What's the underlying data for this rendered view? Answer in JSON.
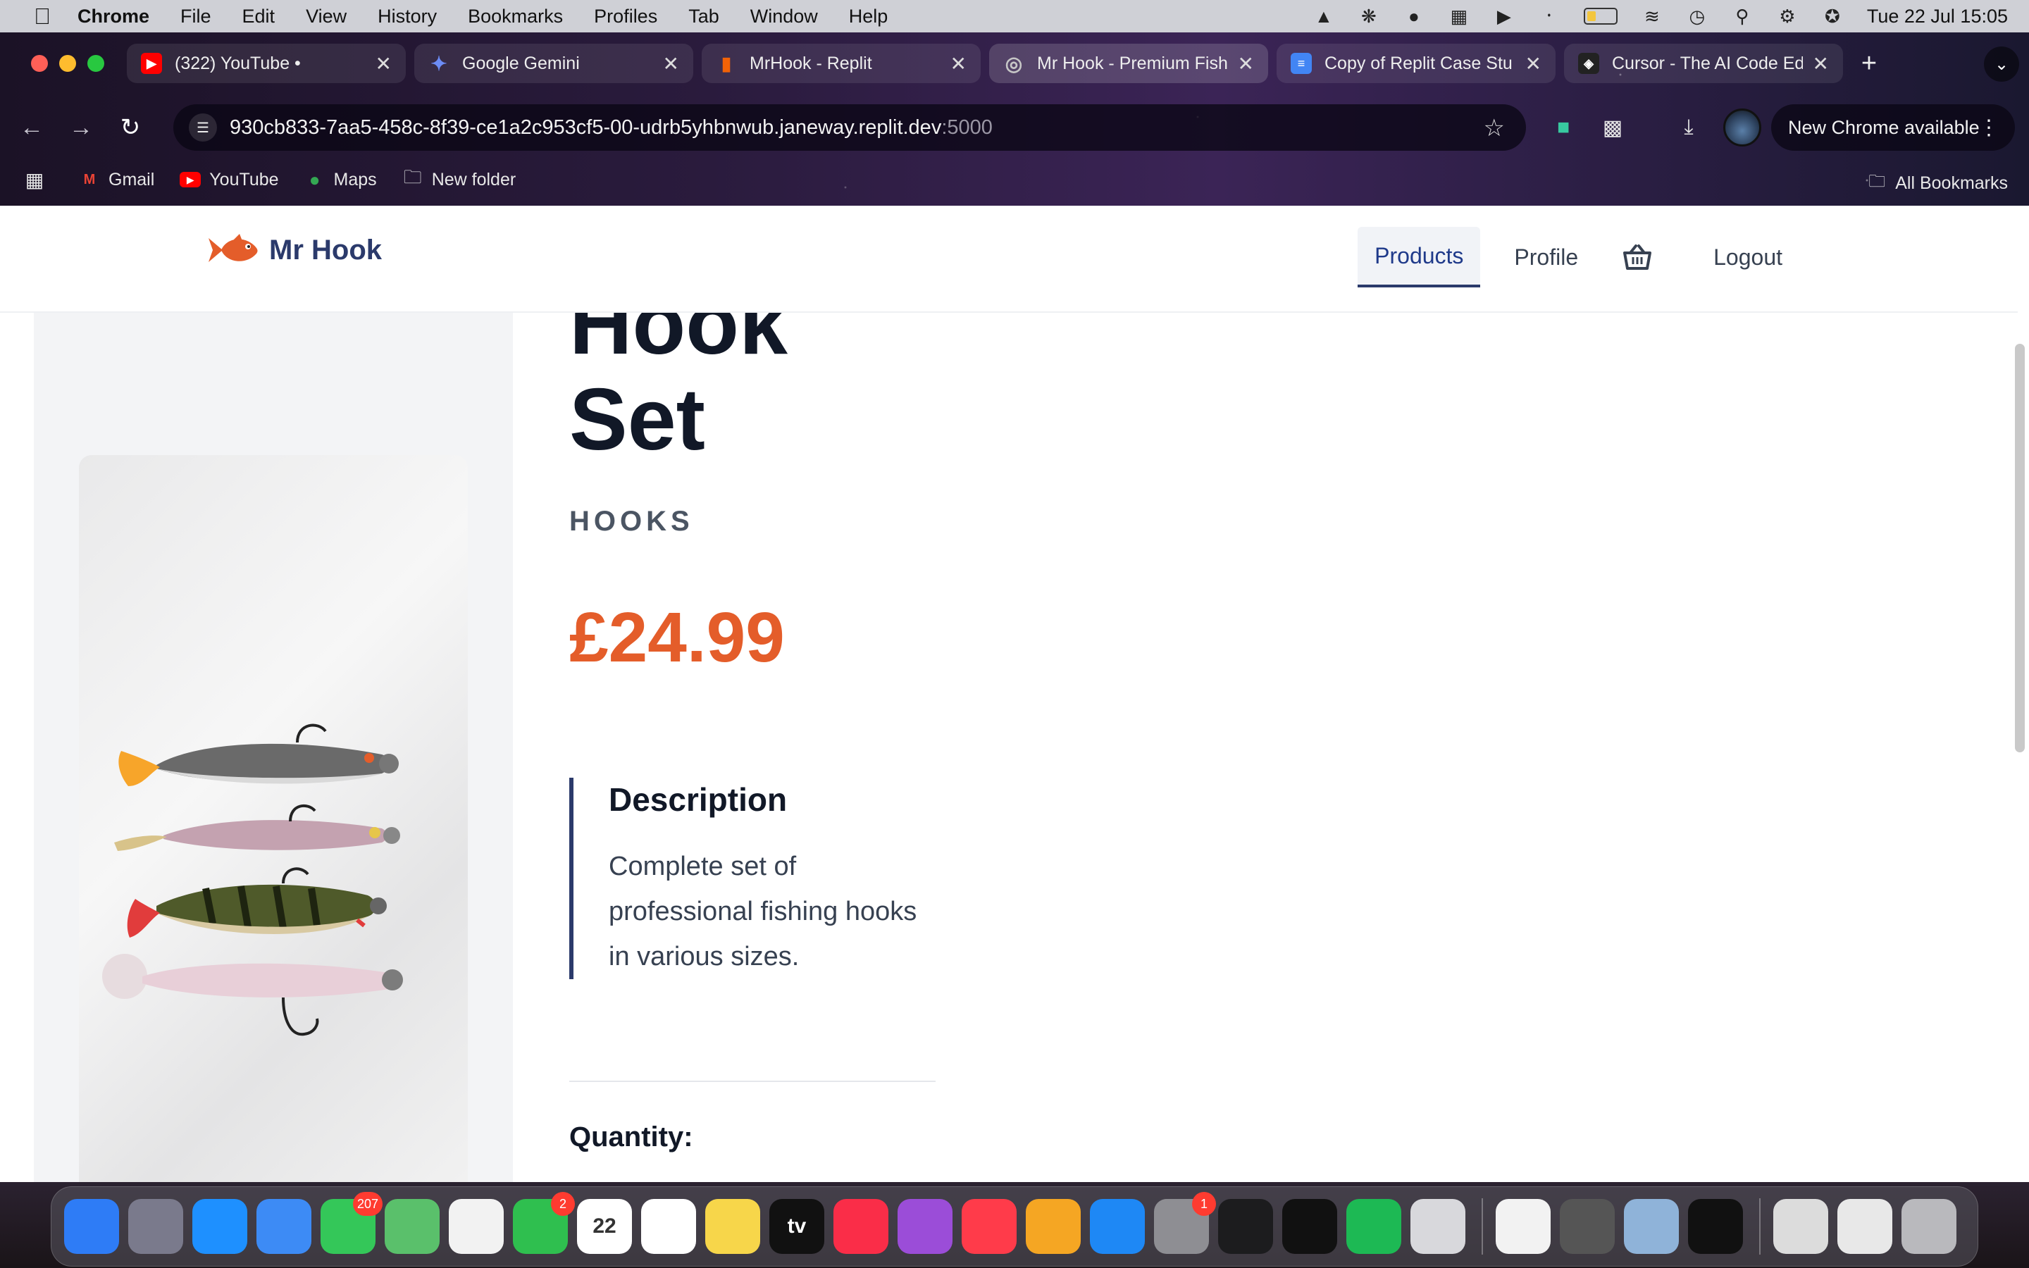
{
  "menubar": {
    "app_name": "Chrome",
    "items": [
      "File",
      "Edit",
      "View",
      "History",
      "Bookmarks",
      "Profiles",
      "Tab",
      "Window",
      "Help"
    ],
    "clock": "Tue 22 Jul  15:05"
  },
  "browser": {
    "tabs": [
      {
        "label": "(322) YouTube •",
        "favicon_color": "#ff0000"
      },
      {
        "label": "Google Gemini",
        "favicon_color": "#4285f4"
      },
      {
        "label": "MrHook - Replit",
        "favicon_color": "#f26207"
      },
      {
        "label": "Mr Hook - Premium Fishi",
        "favicon_color": "#9aa0a6"
      },
      {
        "label": "Copy of Replit Case Stu",
        "favicon_color": "#4285f4"
      },
      {
        "label": "Cursor - The AI Code Ed",
        "favicon_color": "#222222"
      }
    ],
    "url_main": "930cb833-7aa5-458c-8f39-ce1a2c953cf5-00-udrb5yhbnwub.janeway.replit.dev",
    "url_port": ":5000",
    "update_label": "New Chrome available",
    "bookmarks": [
      {
        "label": "Gmail",
        "icon": "gmail-icon"
      },
      {
        "label": "YouTube",
        "icon": "youtube-icon"
      },
      {
        "label": "Maps",
        "icon": "maps-icon"
      },
      {
        "label": "New folder",
        "icon": "folder-icon"
      }
    ],
    "all_bookmarks": "All Bookmarks"
  },
  "site": {
    "brand": "Mr Hook",
    "brand_color": "#2b3a6b",
    "accent_color": "#e45d2a",
    "nav": {
      "products": "Products",
      "profile": "Profile",
      "logout": "Logout"
    }
  },
  "product": {
    "title_lines": [
      "Hook",
      "Set"
    ],
    "category": "HOOKS",
    "price": "£24.99",
    "description_heading": "Description",
    "description": "Complete set of professional fishing hooks in various sizes.",
    "quantity_label": "Quantity:"
  },
  "dock": {
    "apps": [
      {
        "name": "finder-icon",
        "color": "#2e7cf6"
      },
      {
        "name": "launchpad-icon",
        "color": "#7a7a8c"
      },
      {
        "name": "safari-icon",
        "color": "#1e90ff"
      },
      {
        "name": "mail-icon",
        "color": "#3d8bf5"
      },
      {
        "name": "messages-icon",
        "color": "#34c759",
        "badge": "207"
      },
      {
        "name": "maps-icon",
        "color": "#5ac06b"
      },
      {
        "name": "photos-icon",
        "color": "#f2f2f2"
      },
      {
        "name": "facetime-icon",
        "color": "#2fbf4f",
        "badge": "2"
      },
      {
        "name": "calendar-icon",
        "color": "#ffffff",
        "text": "22"
      },
      {
        "name": "reminders-icon",
        "color": "#ffffff"
      },
      {
        "name": "notes-icon",
        "color": "#f7d64a"
      },
      {
        "name": "apple-tv-icon",
        "color": "#111111",
        "text": "tv"
      },
      {
        "name": "music-icon",
        "color": "#fa2d48"
      },
      {
        "name": "podcasts-icon",
        "color": "#9b4dd8"
      },
      {
        "name": "news-icon",
        "color": "#ff3b4a"
      },
      {
        "name": "pages-icon",
        "color": "#f5a623"
      },
      {
        "name": "app-store-icon",
        "color": "#1e88f5"
      },
      {
        "name": "system-settings-icon",
        "color": "#8e8e93",
        "badge": "1"
      },
      {
        "name": "logic-icon",
        "color": "#1c1c1e"
      },
      {
        "name": "linear-icon",
        "color": "#111111"
      },
      {
        "name": "spotify-icon",
        "color": "#1db954"
      },
      {
        "name": "iphone-mirroring-icon",
        "color": "#d8d8dc"
      }
    ],
    "apps_after_sep": [
      {
        "name": "chrome-icon",
        "color": "#f2f2f2"
      },
      {
        "name": "calculator-icon",
        "color": "#555555"
      },
      {
        "name": "preview-icon",
        "color": "#8fb3d9"
      },
      {
        "name": "cursor-icon",
        "color": "#111111"
      }
    ],
    "apps_end": [
      {
        "name": "downloads-stack-icon",
        "color": "#dcdcdc"
      },
      {
        "name": "documents-stack-icon",
        "color": "#e8e8e8"
      },
      {
        "name": "trash-icon",
        "color": "#b9b9bd"
      }
    ]
  }
}
